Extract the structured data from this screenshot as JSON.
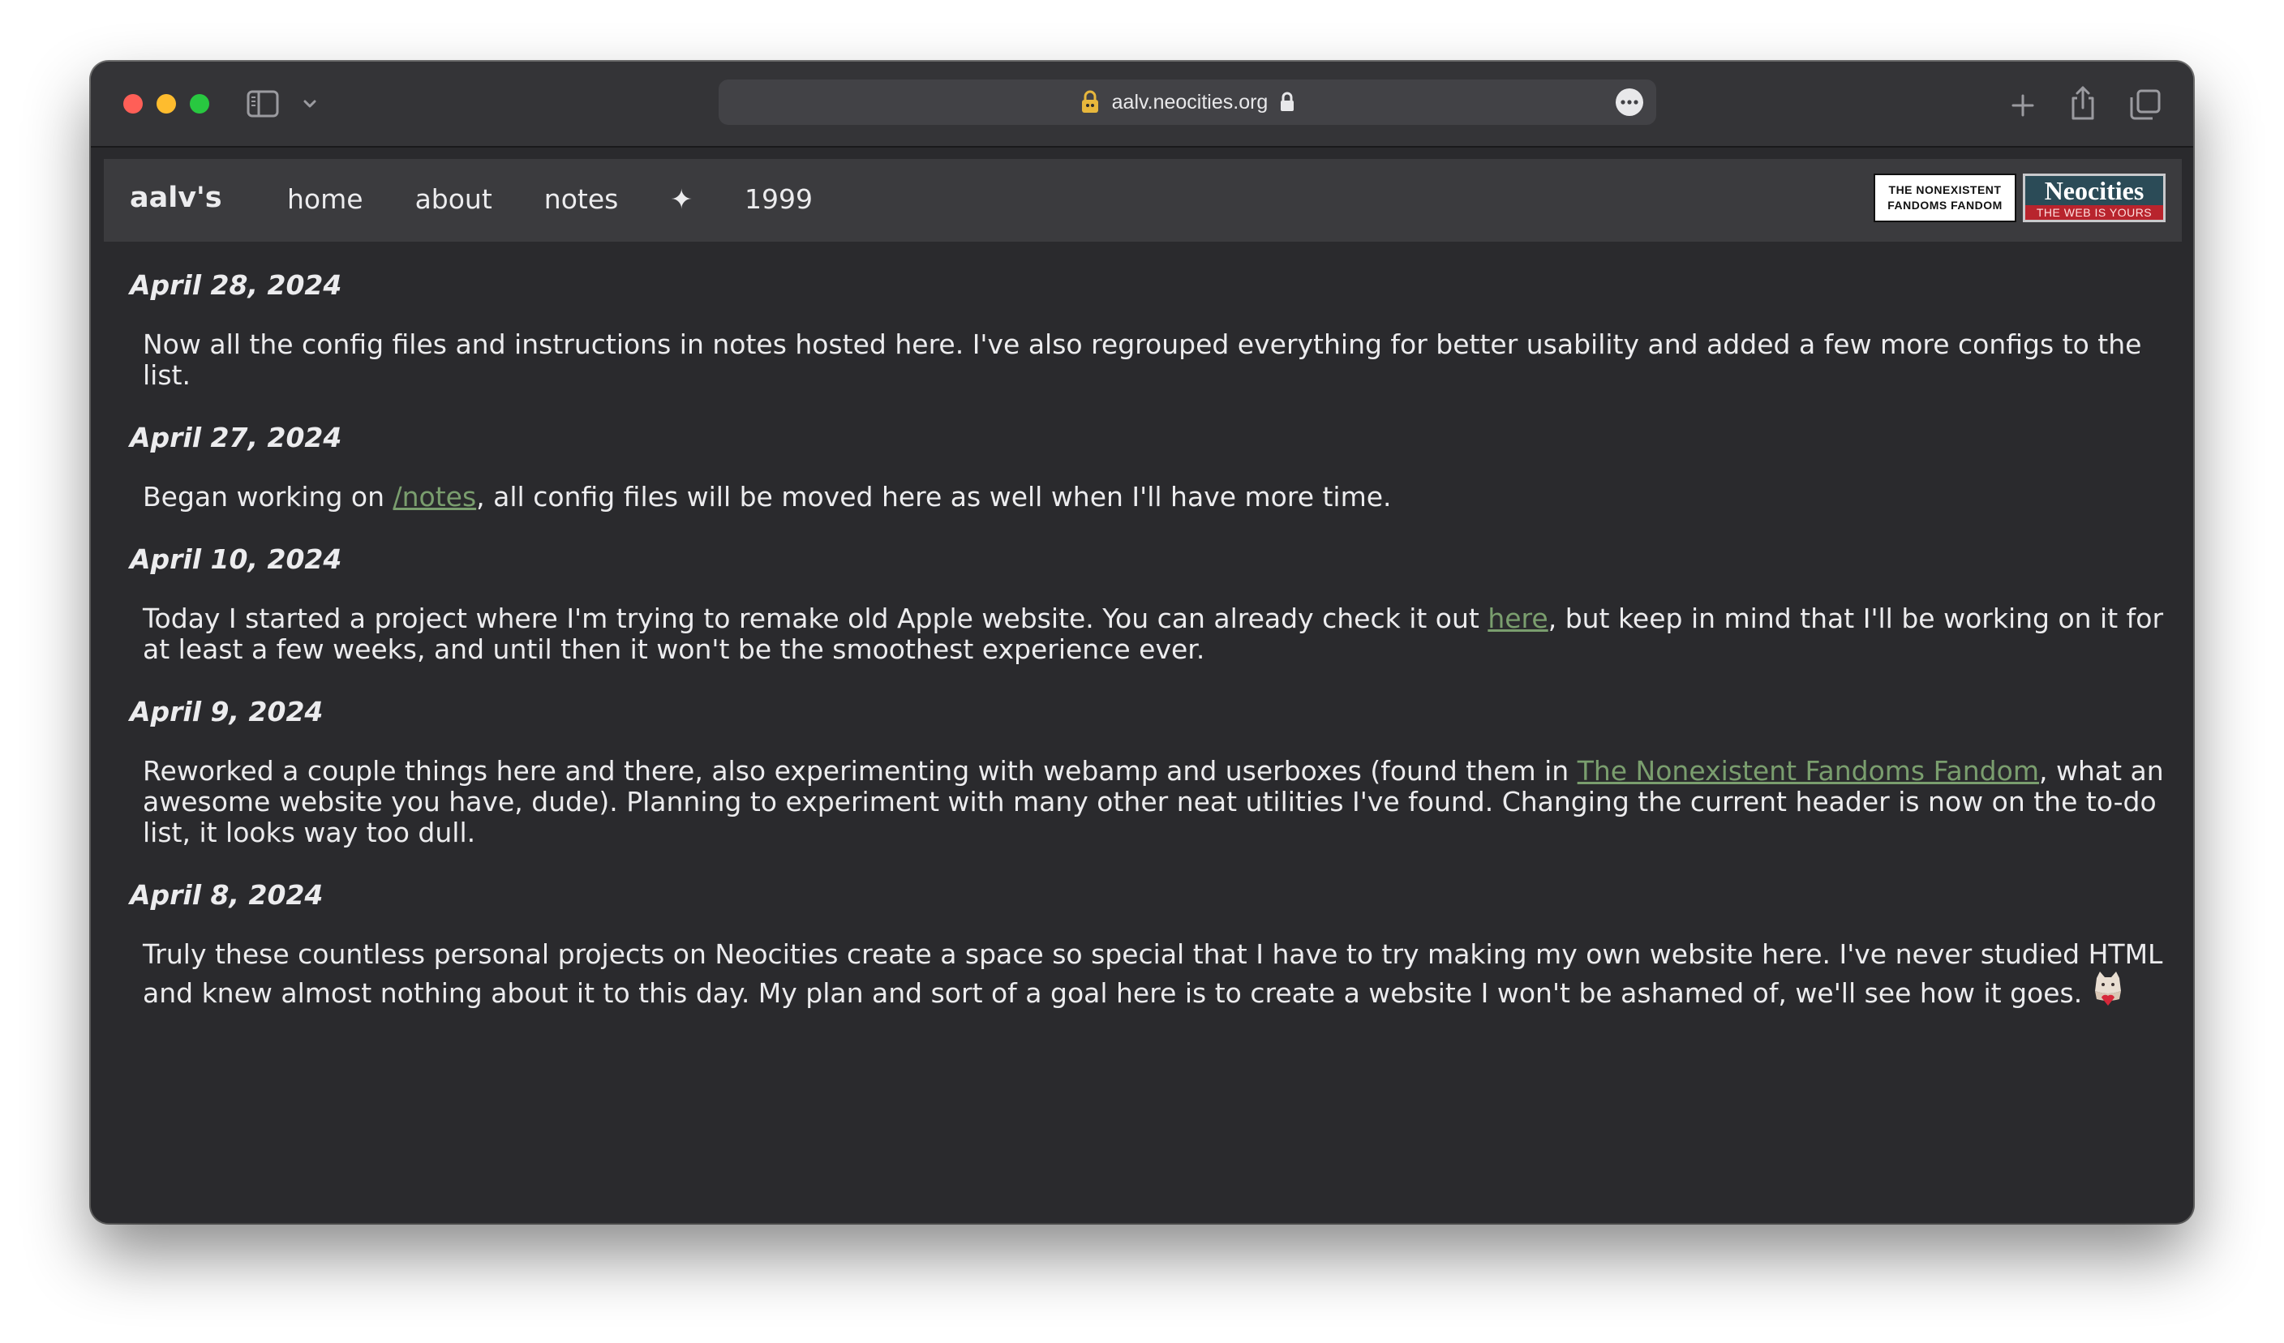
{
  "browser": {
    "url": "aalv.neocities.org"
  },
  "site": {
    "title": "aalv's",
    "nav": [
      "home",
      "about",
      "notes",
      "✦",
      "1999"
    ],
    "badges": {
      "nff_line1": "THE NONEXISTENT",
      "nff_line2": "FANDOMS FANDOM",
      "neocities_title": "Neocities",
      "neocities_tagline": "THE WEB IS YOURS"
    }
  },
  "entries": [
    {
      "date": "April 28, 2024",
      "text": "Now all the config files and instructions in notes hosted here. I've also regrouped everything for better usability and added a few more configs to the list."
    },
    {
      "date": "April 27, 2024",
      "before": "Began working on ",
      "link": "/notes",
      "after": ", all config files will be moved here as well when I'll have more time."
    },
    {
      "date": "April 10, 2024",
      "before": "Today I started a project where I'm trying to remake old Apple website. You can already check it out ",
      "link": "here",
      "after": ", but keep in mind that I'll be working on it for at least a few weeks, and until then it won't be the smoothest experience ever."
    },
    {
      "date": "April 9, 2024",
      "before": "Reworked a couple things here and there, also experimenting with webamp and userboxes (found them in ",
      "link": "The Nonexistent Fandoms Fandom",
      "after": ", what an awesome website you have, dude). Planning to experiment with many other neat utilities I've found. Changing the current header is now on the to-do list, it looks way too dull."
    },
    {
      "date": "April 8, 2024",
      "text": "Truly these countless personal projects on Neocities create a space so special that I have to try making my own website here. I've never studied HTML and knew almost nothing about it to this day. My plan and sort of a goal here is to create a website I won't be ashamed of, we'll see how it goes."
    }
  ]
}
